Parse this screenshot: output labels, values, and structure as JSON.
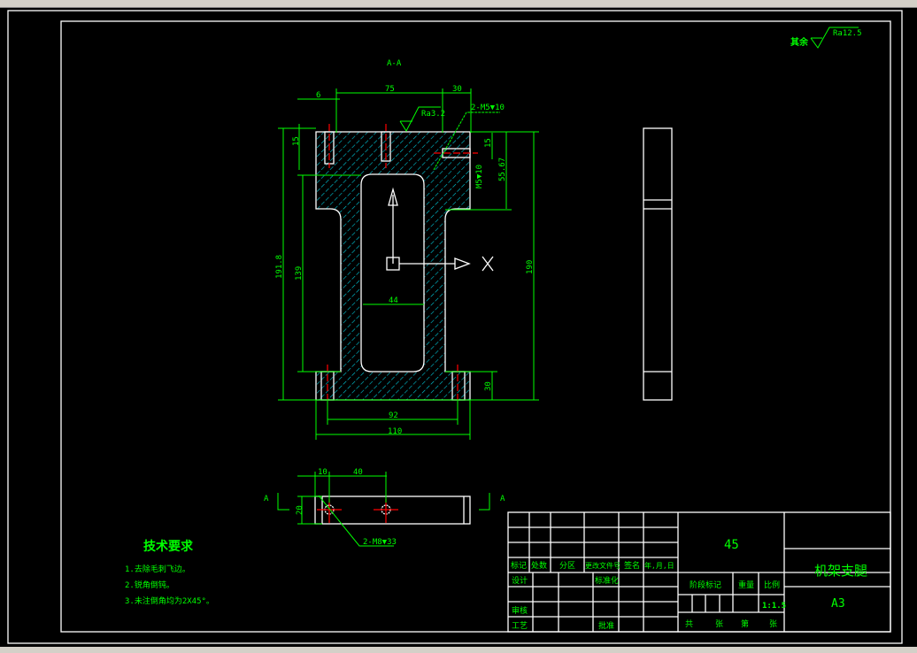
{
  "colors": {
    "background": "#000000",
    "outline": "#ffffff",
    "dimension": "#00ff00",
    "centerline": "#ff0000",
    "hatch": "#00c8d8"
  },
  "roughness_note": {
    "label": "其余",
    "value": "Ra12.5"
  },
  "section_label": "A-A",
  "view_labels": {
    "left": "A",
    "right": "A"
  },
  "dimensions": {
    "top_width": "75",
    "top_right": "30",
    "hole_offset": "6",
    "hole_depth": "15",
    "surface_roughness": "Ra3.2",
    "thread_top": "2-M5▼10",
    "thread_side": "M5▼10",
    "right_15": "15",
    "right_offset": "55.67",
    "overall_height_left": "191.8",
    "inner_height": "139",
    "overall_height": "190",
    "slot_width": "44",
    "foot_height": "30",
    "hole_spacing": "92",
    "overall_width": "110",
    "bottom_10": "10",
    "bottom_40": "40",
    "bottom_height": "20",
    "bottom_thread": "2-M8▼33"
  },
  "tech_requirements": {
    "title": "技术要求",
    "items": [
      "1.去除毛刺飞边。",
      "2.锐角倒钝。",
      "3.未注倒角均为2X45°。"
    ]
  },
  "title_block": {
    "material": "45",
    "part_name": "机架支腿",
    "sheet_size": "A3",
    "headers": [
      "标记",
      "处数",
      "分区",
      "更改文件号",
      "签名",
      "年,月,日"
    ],
    "design": "设计",
    "standardization": "标准化",
    "review": "审核",
    "process": "工艺",
    "approve": "批准",
    "stage_mark": "阶段标记",
    "weight": "重量",
    "scale_label": "比例",
    "scale": "1:1.5",
    "total": "共",
    "sheets": "张",
    "page": "第",
    "page_unit": "张"
  }
}
